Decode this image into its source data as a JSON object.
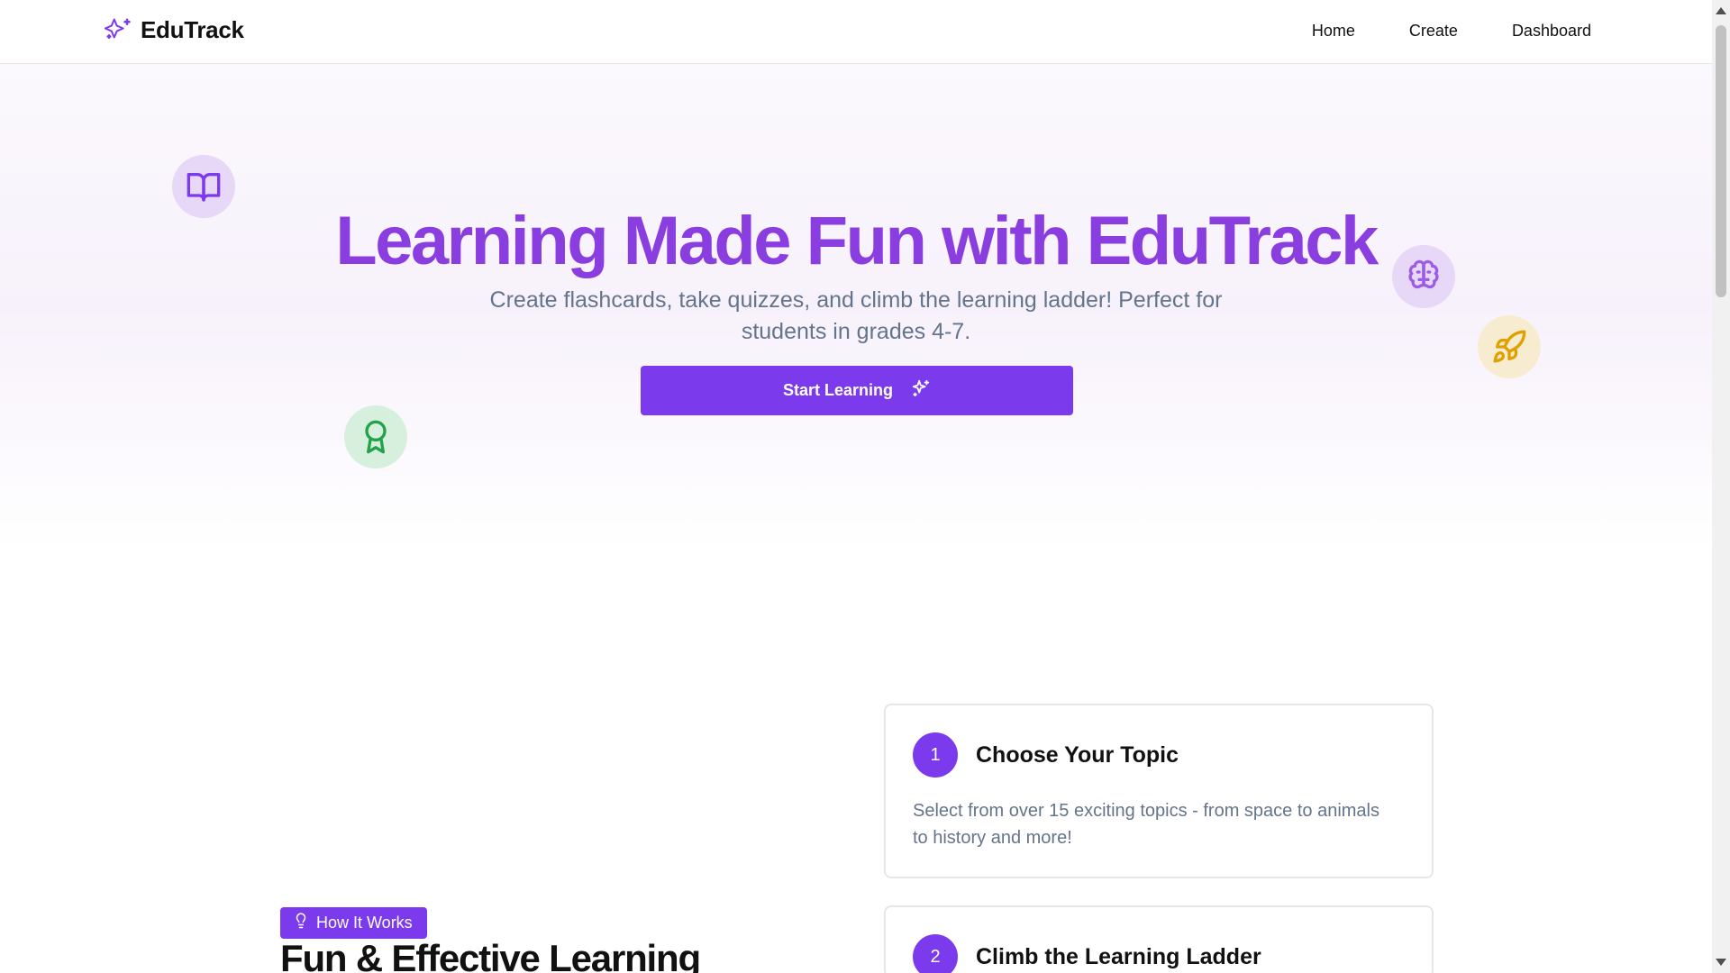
{
  "nav": {
    "brand": "EduTrack",
    "brand_icon": "sparkles-icon",
    "links": [
      "Home",
      "Create",
      "Dashboard"
    ]
  },
  "hero": {
    "title": "Learning Made Fun with EduTrack",
    "subtitle": "Create flashcards, take quizzes, and climb the learning ladder! Perfect for students in grades 4-7.",
    "cta_label": "Start Learning",
    "cta_icon": "sparkles-icon",
    "floating_icons": [
      "book-open-icon",
      "brain-icon",
      "rocket-icon",
      "award-icon"
    ]
  },
  "how_it_works": {
    "badge_label": "How It Works",
    "badge_icon": "lightbulb-icon",
    "title": "Fun & Effective Learning",
    "steps": [
      {
        "number": "1",
        "title": "Choose Your Topic",
        "description": "Select from over 15 exciting topics - from space to animals to history and more!"
      },
      {
        "number": "2",
        "title": "Climb the Learning Ladder",
        "description": ""
      }
    ]
  },
  "colors": {
    "accent": "#7c3aed",
    "title_purple": "#8b3ee0",
    "muted_text": "#64748b",
    "book_bg": "#e8d8f7",
    "rocket_bg": "#f8ecd0",
    "award_bg": "#d6f0dd"
  }
}
